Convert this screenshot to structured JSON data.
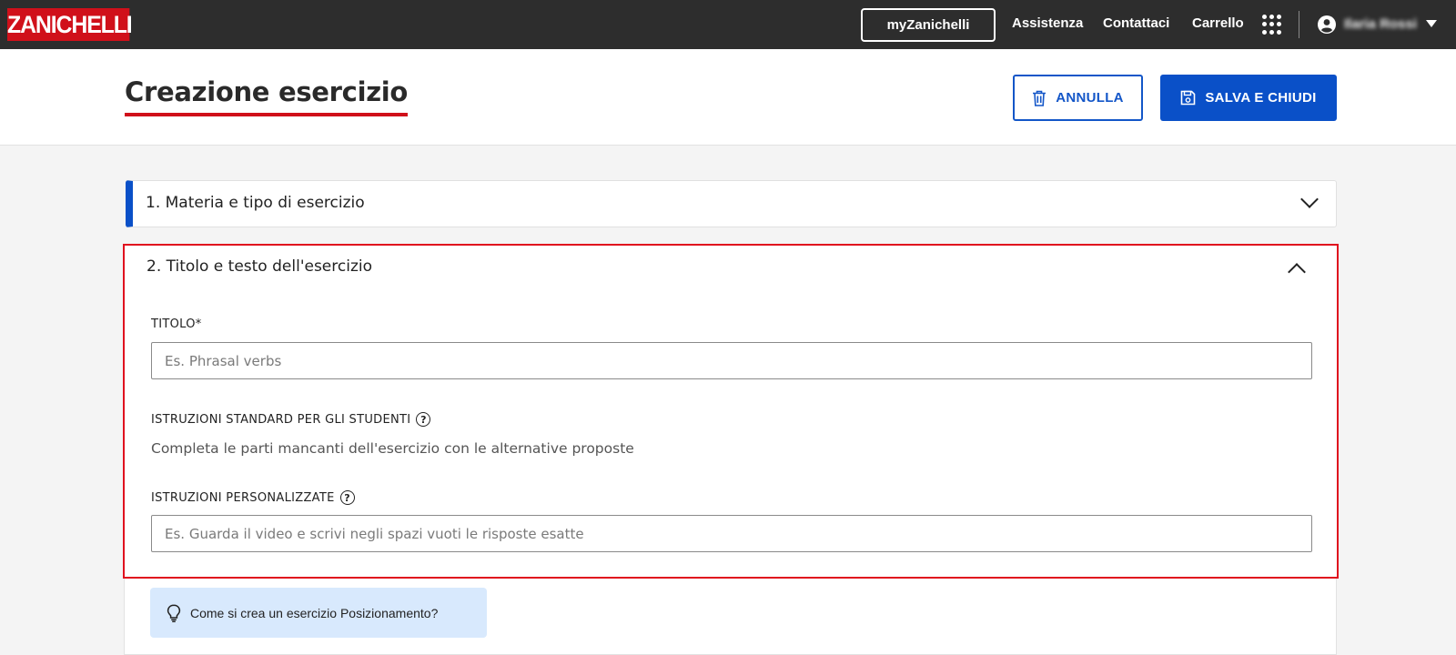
{
  "topbar": {
    "logo_text": "ZANICHELLI",
    "my_button": "myZanichelli",
    "links": [
      "Assistenza",
      "Contattaci",
      "Carrello"
    ],
    "user_name": "Ilaria Rossi",
    "icons": [
      "apps-grid-icon",
      "user-icon",
      "caret-down-icon"
    ]
  },
  "header": {
    "title": "Creazione esercizio",
    "cancel_label": "ANNULLA",
    "save_label": "SALVA E CHIUDI",
    "cancel_icon": "trash-icon",
    "save_icon": "floppy-disk-icon"
  },
  "sections": [
    {
      "title": "1. Materia e tipo di esercizio",
      "state": "collapsed"
    },
    {
      "title": "2. Titolo e testo dell'esercizio",
      "state": "expanded"
    }
  ],
  "form": {
    "title_label": "TITOLO*",
    "title_placeholder": "Es. Phrasal verbs",
    "title_value": "",
    "std_label": "ISTRUZIONI STANDARD PER GLI STUDENTI",
    "std_text": "Completa le parti mancanti dell'esercizio con le alternative proposte",
    "custom_label": "ISTRUZIONI PERSONALIZZATE",
    "custom_placeholder": "Es. Guarda il video e scrivi negli spazi vuoti le risposte esatte",
    "custom_value": ""
  },
  "help": {
    "text": "Come si crea un esercizio Posizionamento?",
    "icon": "lightbulb-icon"
  },
  "colors": {
    "topbar_bg": "#2d2d2d",
    "brand_red": "#d0101a",
    "primary_blue": "#0a50c8",
    "highlight_border": "#e0101e",
    "help_bg": "#d8e9fd"
  }
}
